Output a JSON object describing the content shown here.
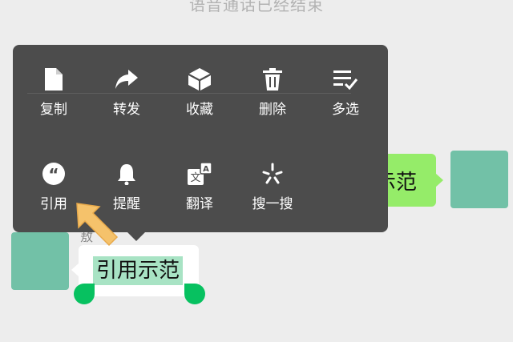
{
  "system_message": "语音通话已经结束",
  "right_bubble_text": "示范",
  "left_name_partial": "敖",
  "left_bubble_text": "引用示范",
  "menu": {
    "row1": [
      {
        "label": "复制",
        "icon": "copy-icon"
      },
      {
        "label": "转发",
        "icon": "forward-icon"
      },
      {
        "label": "收藏",
        "icon": "favorite-cube-icon"
      },
      {
        "label": "删除",
        "icon": "trash-icon"
      },
      {
        "label": "多选",
        "icon": "multi-select-icon"
      }
    ],
    "row2": [
      {
        "label": "引用",
        "icon": "quote-icon"
      },
      {
        "label": "提醒",
        "icon": "bell-icon"
      },
      {
        "label": "翻译",
        "icon": "translate-icon"
      },
      {
        "label": "搜一搜",
        "icon": "search-sparkle-icon"
      }
    ]
  },
  "colors": {
    "menu_bg": "#4c4c4c",
    "green_bubble": "#95ec69",
    "selection": "#a8e3c4",
    "handle": "#07c160",
    "avatar": "#72c1a7",
    "pointer_arrow": "#f5c26b"
  }
}
